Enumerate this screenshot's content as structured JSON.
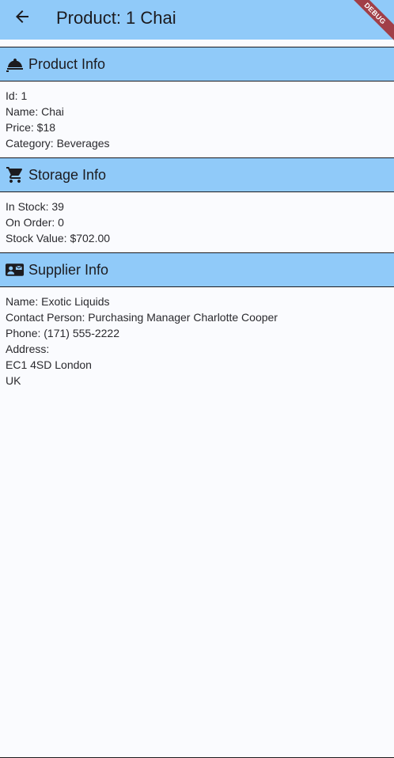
{
  "app_bar": {
    "title": "Product: 1 Chai",
    "back_icon": "arrow-back-icon",
    "debug_banner": "DEBUG",
    "background": "#90caf9"
  },
  "product_info": {
    "title": "Product Info",
    "icon": "room-service-icon",
    "lines": [
      "Id: 1",
      "Name: Chai",
      "Price: $18",
      "Category: Beverages"
    ]
  },
  "storage_info": {
    "title": "Storage Info",
    "icon": "shopping-cart-icon",
    "lines": [
      "In Stock: 39",
      "On Order: 0",
      "Stock Value: $702.00"
    ]
  },
  "supplier_info": {
    "title": "Supplier Info",
    "icon": "contact-mail-icon",
    "lines": [
      "Name: Exotic Liquids",
      "Contact Person: Purchasing Manager Charlotte Cooper",
      "Phone: (171) 555-2222",
      "Address:",
      "EC1 4SD London",
      "UK"
    ]
  }
}
